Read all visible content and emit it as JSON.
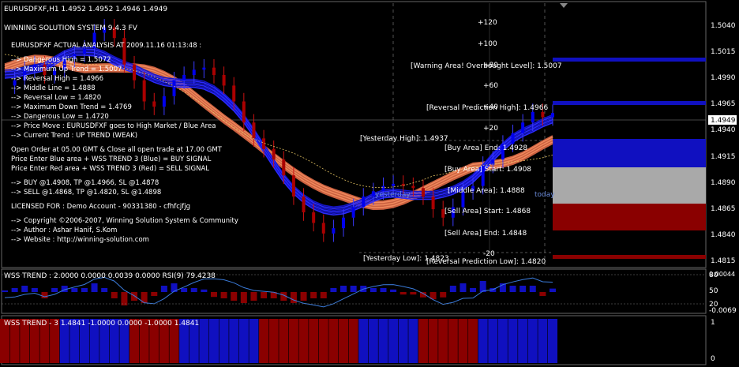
{
  "window": {
    "title": "EURUSDFXF,H1  1.4952 1.4952 1.4946 1.4949"
  },
  "system": {
    "name": "WINNING SOLUTION SYSTEM 9.4.3 FV"
  },
  "analysis": {
    "header": "EURUSDFXF ACTUAL ANALYSIS AT 2009.11.16 01:13:48 :",
    "lines": [
      "--> Dangerous High = 1.5072",
      "--> Maximum Up Trend = 1.5007",
      "--> Reversal High = 1.4966",
      "--> Middle Line = 1.4888",
      "--> Reversal Low = 1.4820",
      "--> Maximum Down Trend = 1.4769",
      "--> Dangerous Low = 1.4720",
      "--> Price Move : EURUSDFXF goes to High Market / Blue Area",
      "--> Current Trend : UP TREND (WEAK)"
    ],
    "rules": [
      "Open Order at 05.00 GMT & Close all open trade at 17.00 GMT",
      "Price Enter Blue area + WSS TREND 3 (Blue) = BUY SIGNAL",
      "Price Enter Red area + WSS TREND 3 (Red) = SELL SIGNAL"
    ],
    "signals": [
      "--> BUY @1.4908, TP @1.4966, SL @1.4878",
      "--> SELL @1.4868, TP @1.4820, SL @1.4898"
    ],
    "license": "LICENSED FOR : Demo Account - 90331380 - cfhfcjfjg",
    "credits": [
      "--> Copyright ©2006-2007, Winning Solution System & Community",
      "--> Author : Ashar Hanif, S.Kom",
      "--> Website : http://winning-solution.com"
    ]
  },
  "levels_labels": {
    "warning": "[Warning Area! Overbought Level]: 1.5007",
    "rev_high": "[Reversal Prediction High]: 1.4966",
    "yest_high": "[Yesterday High]: 1.4937",
    "buy_end": "[Buy Area] End: 1.4928",
    "buy_start": "[Buy Area] Start: 1.4908",
    "middle": "[Middle Area]: 1.4888",
    "sell_start": "[Sell Area] Start: 1.4868",
    "sell_end": "[Sell Area] End: 1.4848",
    "yest_low": "[Yesterday Low]: 1.4823",
    "rev_low": "[Reversal Prediction Low]: 1.4820",
    "yesterday": "yesterday",
    "today": "today"
  },
  "pip_scale": [
    "+120",
    "+100",
    "+80",
    "+60",
    "+40",
    "+20",
    "-20"
  ],
  "price_axis": {
    "ticks": [
      "1.5040",
      "1.5015",
      "1.4990",
      "1.4965",
      "1.4940",
      "1.4915",
      "1.4890",
      "1.4865",
      "1.4840",
      "1.4815"
    ],
    "current": "1.4949"
  },
  "indicator1": {
    "title": "WSS TREND : 2.0000 0.0000 0.0039 0.0000  RSI(9) 79.4238",
    "axis": [
      "80",
      "20",
      "0.00044",
      "-0.0069"
    ],
    "ticks_extra": [
      "50"
    ]
  },
  "indicator2": {
    "title": "WSS TREND - 3  1.4841 -1.0000 0.0000 -1.0000 1.4841",
    "axis": [
      "1",
      "0"
    ]
  },
  "colors": {
    "blue": "#1a1aee",
    "red": "#8b0000",
    "orange": "#e07a50",
    "buy_area": "#1010c0",
    "sell_area": "#8a0000",
    "middle_area": "#a9a9a9",
    "price_label_bg": "#ffffff"
  },
  "chart_data": {
    "type": "line",
    "symbol": "EURUSDFXF",
    "timeframe": "H1",
    "ylim": [
      1.4805,
      1.505
    ],
    "levels": {
      "dangerous_high": 1.5072,
      "max_up_trend": 1.5007,
      "reversal_high": 1.4966,
      "yesterday_high": 1.4937,
      "buy_end": 1.4928,
      "buy_start": 1.4908,
      "middle": 1.4888,
      "sell_start": 1.4868,
      "sell_end": 1.4848,
      "yesterday_low": 1.4823,
      "reversal_low": 1.482,
      "current": 1.4949
    },
    "price_series": [
      1.4975,
      1.498,
      1.499,
      1.4995,
      1.4985,
      1.499,
      1.5,
      1.5005,
      1.501,
      1.5025,
      1.503,
      1.502,
      1.4995,
      1.498,
      1.496,
      1.4955,
      1.4965,
      1.498,
      1.4985,
      1.499,
      1.4992,
      1.4985,
      1.4975,
      1.496,
      1.494,
      1.4925,
      1.4915,
      1.4905,
      1.489,
      1.487,
      1.4855,
      1.4845,
      1.4835,
      1.484,
      1.485,
      1.486,
      1.487,
      1.4875,
      1.488,
      1.4882,
      1.488,
      1.4878,
      1.487,
      1.4858,
      1.485,
      1.486,
      1.4875,
      1.488,
      1.49,
      1.4905,
      1.492,
      1.493,
      1.494,
      1.495,
      1.4945,
      1.4949
    ]
  }
}
